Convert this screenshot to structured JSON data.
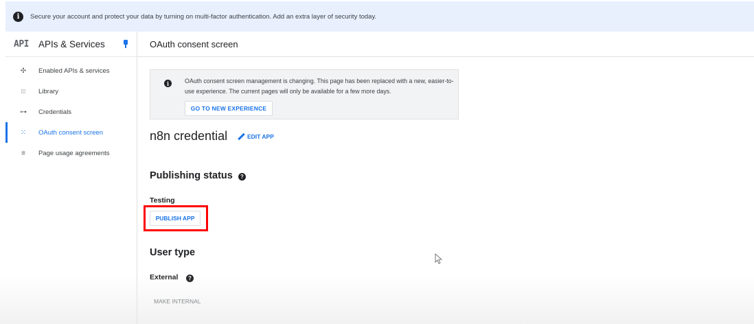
{
  "banner": {
    "text": "Secure your account and protect your data by turning on multi-factor authentication. Add an extra layer of security today.",
    "icon": "info-icon"
  },
  "sidebar": {
    "logo": "API",
    "title": "APIs & Services",
    "items": [
      {
        "label": "Enabled APIs & services",
        "icon": "enabled-apis-icon",
        "glyph": "✣"
      },
      {
        "label": "Library",
        "icon": "library-icon",
        "glyph": "⁞⁞⁞"
      },
      {
        "label": "Credentials",
        "icon": "key-icon",
        "glyph": "⊶"
      },
      {
        "label": "OAuth consent screen",
        "icon": "oauth-consent-icon",
        "glyph": "⁙",
        "active": true
      },
      {
        "label": "Page usage agreements",
        "icon": "settings-list-icon",
        "glyph": "≡"
      }
    ]
  },
  "main": {
    "page_title": "OAuth consent screen",
    "notice": {
      "text": "OAuth consent screen management is changing. This page has been replaced with a new, easier-to-use experience. The current pages will only be available for a few more days.",
      "button": "GO TO NEW EXPERIENCE"
    },
    "app_name": "n8n credential",
    "edit_app": "EDIT APP",
    "publishing_status": {
      "heading": "Publishing status",
      "status": "Testing",
      "button": "PUBLISH APP"
    },
    "user_type": {
      "heading": "User type",
      "value": "External",
      "button": "MAKE INTERNAL"
    }
  },
  "colors": {
    "accent": "#1a73e8",
    "banner_bg": "#e8f0fe",
    "highlight": "#ff0000"
  }
}
